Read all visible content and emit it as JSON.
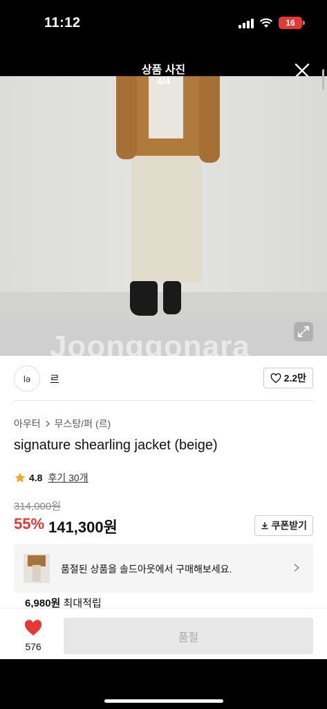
{
  "status_bar": {
    "time": "11:12",
    "battery": "16",
    "battery_color": "#e53935"
  },
  "viewer": {
    "title": "상품 사진",
    "counter": "4/4",
    "watermark": "Joonggonara"
  },
  "seller": {
    "avatar_text": "lə",
    "name": "르",
    "likes_label": "2.2만"
  },
  "product": {
    "breadcrumb": [
      "아우터",
      "무스탕/퍼 (르)"
    ],
    "title": "signature shearling jacket (beige)",
    "rating": "4.8",
    "reviews_label": "후기 30개",
    "original_price": "314,000원",
    "discount": "55%",
    "price": "141,300원",
    "coupon_label": "쿠폰받기"
  },
  "soldout_banner": {
    "message": "품절된 상품을 솔드아웃에서 구매해보세요."
  },
  "points": {
    "amount": "6,980원",
    "label": "최대적립"
  },
  "bottom": {
    "heart_count": "576",
    "buy_label": "품절"
  },
  "colors": {
    "accent_red": "#e53935",
    "star": "#f5a623"
  }
}
